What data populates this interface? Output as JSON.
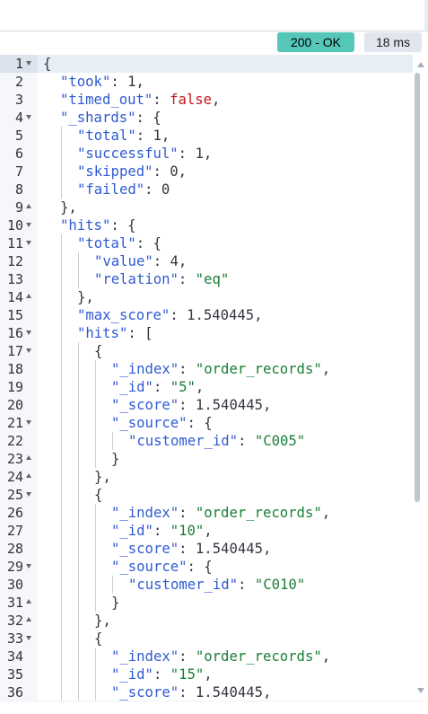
{
  "status": {
    "code_label": "200 - OK",
    "time_label": "18 ms"
  },
  "lines": [
    {
      "n": "1",
      "fold": "open",
      "indent": 0,
      "segs": [
        [
          "p",
          "{"
        ]
      ]
    },
    {
      "n": "2",
      "fold": "",
      "indent": 1,
      "segs": [
        [
          "k",
          "\"took\""
        ],
        [
          "p",
          ": "
        ],
        [
          "n",
          "1"
        ],
        [
          "p",
          ","
        ]
      ]
    },
    {
      "n": "3",
      "fold": "",
      "indent": 1,
      "segs": [
        [
          "k",
          "\"timed_out\""
        ],
        [
          "p",
          ": "
        ],
        [
          "b",
          "false"
        ],
        [
          "p",
          ","
        ]
      ]
    },
    {
      "n": "4",
      "fold": "open",
      "indent": 1,
      "segs": [
        [
          "k",
          "\"_shards\""
        ],
        [
          "p",
          ": {"
        ]
      ]
    },
    {
      "n": "5",
      "fold": "",
      "indent": 2,
      "segs": [
        [
          "k",
          "\"total\""
        ],
        [
          "p",
          ": "
        ],
        [
          "n",
          "1"
        ],
        [
          "p",
          ","
        ]
      ]
    },
    {
      "n": "6",
      "fold": "",
      "indent": 2,
      "segs": [
        [
          "k",
          "\"successful\""
        ],
        [
          "p",
          ": "
        ],
        [
          "n",
          "1"
        ],
        [
          "p",
          ","
        ]
      ]
    },
    {
      "n": "7",
      "fold": "",
      "indent": 2,
      "segs": [
        [
          "k",
          "\"skipped\""
        ],
        [
          "p",
          ": "
        ],
        [
          "n",
          "0"
        ],
        [
          "p",
          ","
        ]
      ]
    },
    {
      "n": "8",
      "fold": "",
      "indent": 2,
      "segs": [
        [
          "k",
          "\"failed\""
        ],
        [
          "p",
          ": "
        ],
        [
          "n",
          "0"
        ]
      ]
    },
    {
      "n": "9",
      "fold": "close",
      "indent": 1,
      "segs": [
        [
          "p",
          "},"
        ]
      ]
    },
    {
      "n": "10",
      "fold": "open",
      "indent": 1,
      "segs": [
        [
          "k",
          "\"hits\""
        ],
        [
          "p",
          ": {"
        ]
      ]
    },
    {
      "n": "11",
      "fold": "open",
      "indent": 2,
      "segs": [
        [
          "k",
          "\"total\""
        ],
        [
          "p",
          ": {"
        ]
      ]
    },
    {
      "n": "12",
      "fold": "",
      "indent": 3,
      "segs": [
        [
          "k",
          "\"value\""
        ],
        [
          "p",
          ": "
        ],
        [
          "n",
          "4"
        ],
        [
          "p",
          ","
        ]
      ]
    },
    {
      "n": "13",
      "fold": "",
      "indent": 3,
      "segs": [
        [
          "k",
          "\"relation\""
        ],
        [
          "p",
          ": "
        ],
        [
          "s",
          "\"eq\""
        ]
      ]
    },
    {
      "n": "14",
      "fold": "close",
      "indent": 2,
      "segs": [
        [
          "p",
          "},"
        ]
      ]
    },
    {
      "n": "15",
      "fold": "",
      "indent": 2,
      "segs": [
        [
          "k",
          "\"max_score\""
        ],
        [
          "p",
          ": "
        ],
        [
          "n",
          "1.540445"
        ],
        [
          "p",
          ","
        ]
      ]
    },
    {
      "n": "16",
      "fold": "open",
      "indent": 2,
      "segs": [
        [
          "k",
          "\"hits\""
        ],
        [
          "p",
          ": ["
        ]
      ]
    },
    {
      "n": "17",
      "fold": "open",
      "indent": 3,
      "segs": [
        [
          "p",
          "{"
        ]
      ]
    },
    {
      "n": "18",
      "fold": "",
      "indent": 4,
      "segs": [
        [
          "k",
          "\"_index\""
        ],
        [
          "p",
          ": "
        ],
        [
          "s",
          "\"order_records\""
        ],
        [
          "p",
          ","
        ]
      ]
    },
    {
      "n": "19",
      "fold": "",
      "indent": 4,
      "segs": [
        [
          "k",
          "\"_id\""
        ],
        [
          "p",
          ": "
        ],
        [
          "s",
          "\"5\""
        ],
        [
          "p",
          ","
        ]
      ]
    },
    {
      "n": "20",
      "fold": "",
      "indent": 4,
      "segs": [
        [
          "k",
          "\"_score\""
        ],
        [
          "p",
          ": "
        ],
        [
          "n",
          "1.540445"
        ],
        [
          "p",
          ","
        ]
      ]
    },
    {
      "n": "21",
      "fold": "open",
      "indent": 4,
      "segs": [
        [
          "k",
          "\"_source\""
        ],
        [
          "p",
          ": {"
        ]
      ]
    },
    {
      "n": "22",
      "fold": "",
      "indent": 5,
      "segs": [
        [
          "k",
          "\"customer_id\""
        ],
        [
          "p",
          ": "
        ],
        [
          "s",
          "\"C005\""
        ]
      ]
    },
    {
      "n": "23",
      "fold": "close",
      "indent": 4,
      "segs": [
        [
          "p",
          "}"
        ]
      ]
    },
    {
      "n": "24",
      "fold": "close",
      "indent": 3,
      "segs": [
        [
          "p",
          "},"
        ]
      ]
    },
    {
      "n": "25",
      "fold": "open",
      "indent": 3,
      "segs": [
        [
          "p",
          "{"
        ]
      ]
    },
    {
      "n": "26",
      "fold": "",
      "indent": 4,
      "segs": [
        [
          "k",
          "\"_index\""
        ],
        [
          "p",
          ": "
        ],
        [
          "s",
          "\"order_records\""
        ],
        [
          "p",
          ","
        ]
      ]
    },
    {
      "n": "27",
      "fold": "",
      "indent": 4,
      "segs": [
        [
          "k",
          "\"_id\""
        ],
        [
          "p",
          ": "
        ],
        [
          "s",
          "\"10\""
        ],
        [
          "p",
          ","
        ]
      ]
    },
    {
      "n": "28",
      "fold": "",
      "indent": 4,
      "segs": [
        [
          "k",
          "\"_score\""
        ],
        [
          "p",
          ": "
        ],
        [
          "n",
          "1.540445"
        ],
        [
          "p",
          ","
        ]
      ]
    },
    {
      "n": "29",
      "fold": "open",
      "indent": 4,
      "segs": [
        [
          "k",
          "\"_source\""
        ],
        [
          "p",
          ": {"
        ]
      ]
    },
    {
      "n": "30",
      "fold": "",
      "indent": 5,
      "segs": [
        [
          "k",
          "\"customer_id\""
        ],
        [
          "p",
          ": "
        ],
        [
          "s",
          "\"C010\""
        ]
      ]
    },
    {
      "n": "31",
      "fold": "close",
      "indent": 4,
      "segs": [
        [
          "p",
          "}"
        ]
      ]
    },
    {
      "n": "32",
      "fold": "close",
      "indent": 3,
      "segs": [
        [
          "p",
          "},"
        ]
      ]
    },
    {
      "n": "33",
      "fold": "open",
      "indent": 3,
      "segs": [
        [
          "p",
          "{"
        ]
      ]
    },
    {
      "n": "34",
      "fold": "",
      "indent": 4,
      "segs": [
        [
          "k",
          "\"_index\""
        ],
        [
          "p",
          ": "
        ],
        [
          "s",
          "\"order_records\""
        ],
        [
          "p",
          ","
        ]
      ]
    },
    {
      "n": "35",
      "fold": "",
      "indent": 4,
      "segs": [
        [
          "k",
          "\"_id\""
        ],
        [
          "p",
          ": "
        ],
        [
          "s",
          "\"15\""
        ],
        [
          "p",
          ","
        ]
      ]
    },
    {
      "n": "36",
      "fold": "",
      "indent": 4,
      "segs": [
        [
          "k",
          "\"_score\""
        ],
        [
          "p",
          ": "
        ],
        [
          "n",
          "1.540445"
        ],
        [
          "p",
          ","
        ]
      ]
    }
  ]
}
